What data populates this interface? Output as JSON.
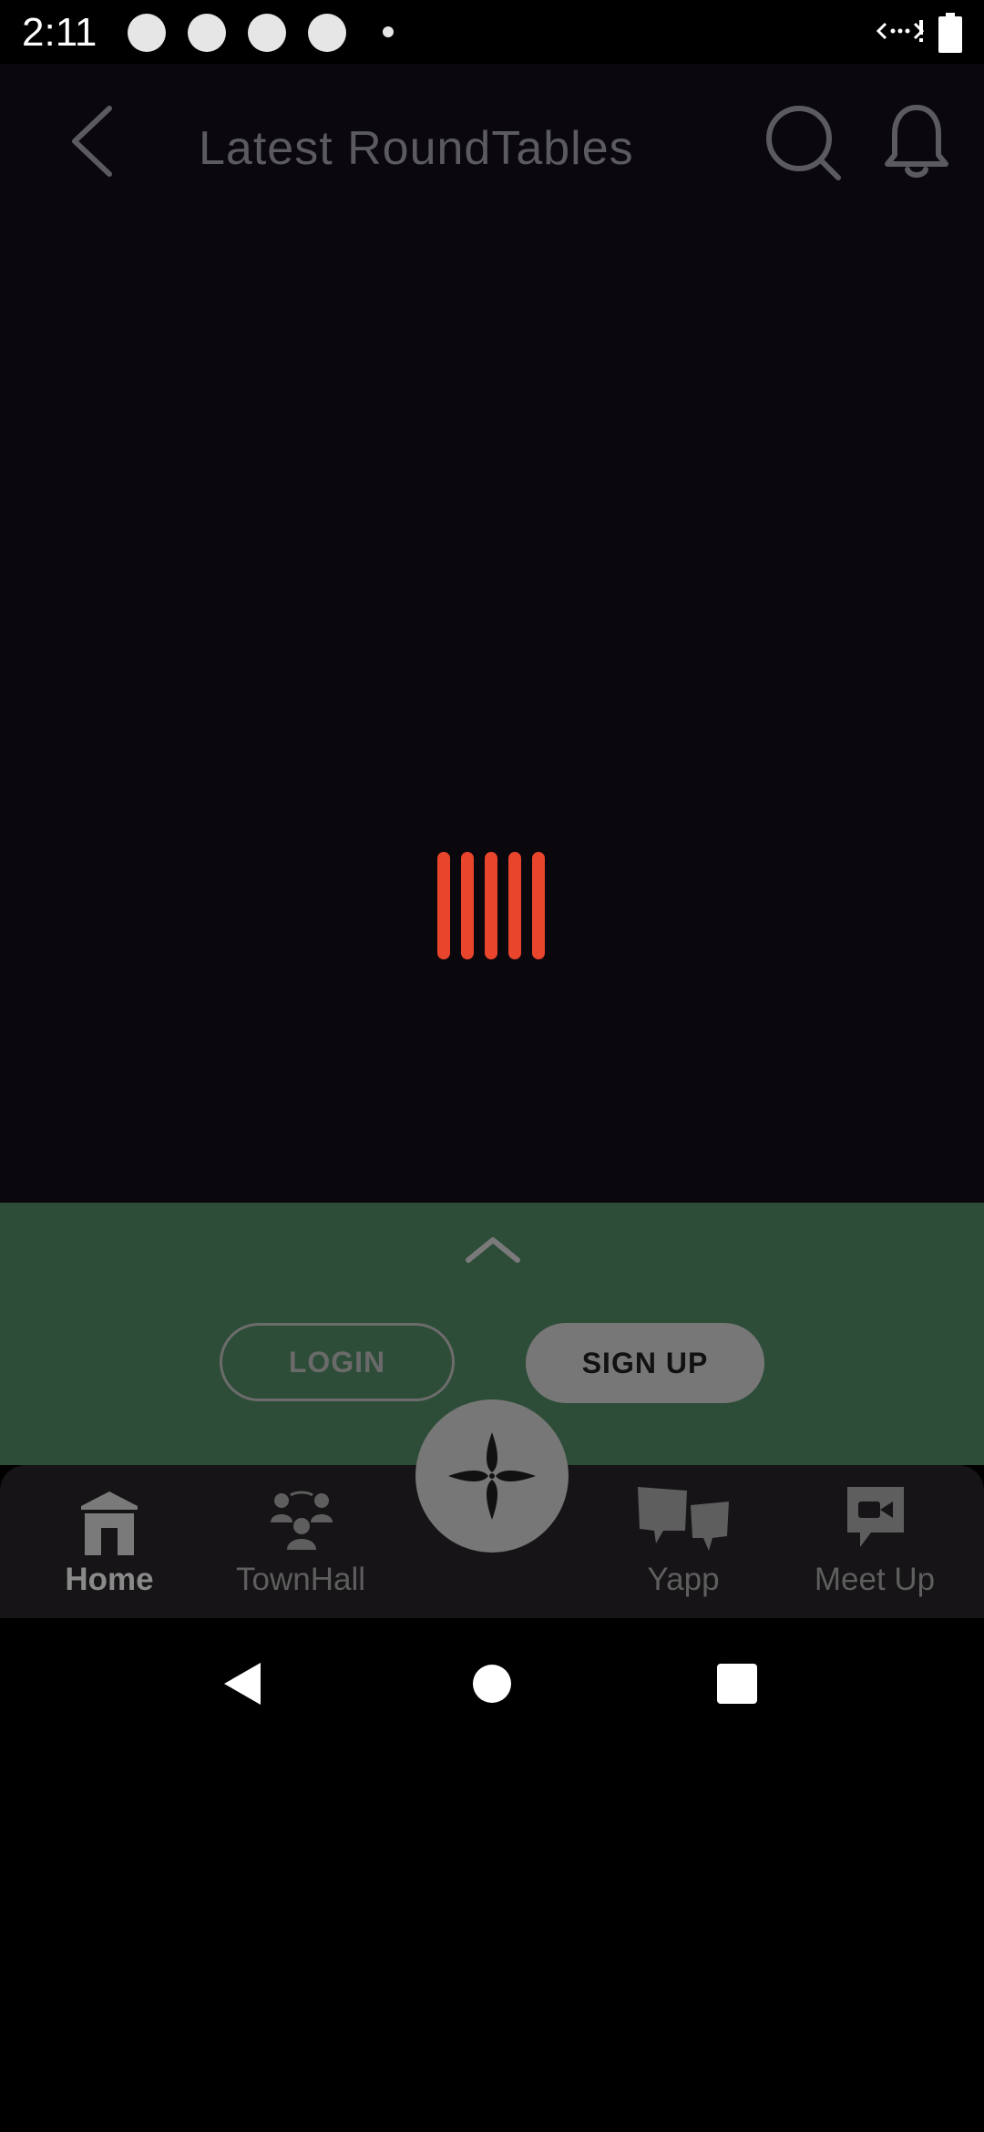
{
  "status_bar": {
    "time": "2:11"
  },
  "header": {
    "title": "Latest RoundTables",
    "back_icon": "chevron-left-icon",
    "search_icon": "search-icon",
    "bell_icon": "bell-icon"
  },
  "loader": {
    "bar_count": 5,
    "color": "#e8452c"
  },
  "auth_sheet": {
    "login_label": "LOGIN",
    "signup_label": "SIGN UP",
    "background": "#2d4d38"
  },
  "bottom_nav": {
    "items": [
      {
        "label": "Home",
        "icon": "house-icon",
        "active": true
      },
      {
        "label": "TownHall",
        "icon": "people-group-icon",
        "active": false
      },
      {
        "label": "Yapp",
        "icon": "chat-bubbles-icon",
        "active": false
      },
      {
        "label": "Meet Up",
        "icon": "video-chat-icon",
        "active": false
      }
    ],
    "center_icon": "four-petal-icon"
  }
}
